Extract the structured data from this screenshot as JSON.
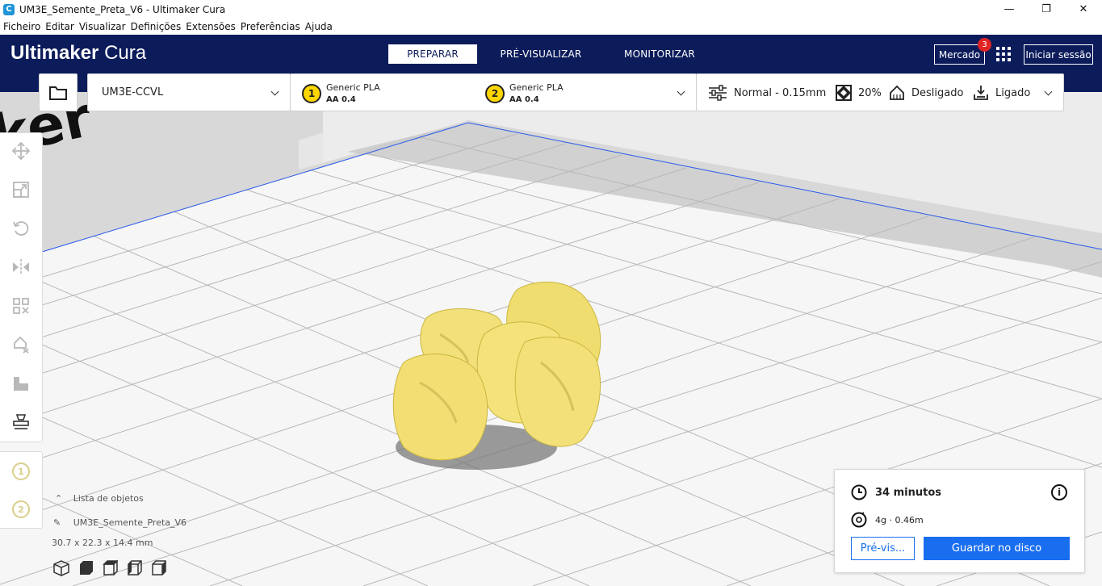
{
  "window": {
    "title": "UM3E_Semente_Preta_V6 - Ultimaker Cura",
    "minimize": "—",
    "restore": "❐",
    "close": "✕"
  },
  "menu": [
    "Ficheiro",
    "Editar",
    "Visualizar",
    "Definições",
    "Extensões",
    "Preferências",
    "Ajuda"
  ],
  "header": {
    "logo_bold": "Ultimaker",
    "logo_light": "Cura",
    "tabs": [
      "PREPARAR",
      "PRÉ-VISUALIZAR",
      "MONITORIZAR"
    ],
    "active_tab": "PREPARAR",
    "market_label": "Mercado",
    "market_badge": "3",
    "signin_label": "Iniciar sessão",
    "colors": {
      "header_bg": "#0c1c5b",
      "accent": "#196ef0"
    }
  },
  "config": {
    "printer": "UM3E-CCVL",
    "extruders": [
      {
        "index": "1",
        "material": "Generic PLA",
        "nozzle": "AA 0.4"
      },
      {
        "index": "2",
        "material": "Generic PLA",
        "nozzle": "AA 0.4"
      }
    ],
    "profile": "Normal - 0.15mm",
    "infill": "20%",
    "support": "Desligado",
    "adhesion": "Ligado"
  },
  "tools": [
    "move-icon",
    "scale-icon",
    "rotate-icon",
    "mirror-icon",
    "per-model-settings-icon",
    "support-blocker-icon",
    "layer-icon",
    "build-plate-icon"
  ],
  "extruder_buttons": [
    "1",
    "2"
  ],
  "object_list": {
    "header": "Lista de objetos",
    "name": "UM3E_Semente_Preta_V6",
    "dimensions": "30.7 x 22.3 x 14.4 mm"
  },
  "print_info": {
    "time": "34 minutos",
    "material": "4g · 0.46m",
    "preview_label": "Pré-vis...",
    "save_label": "Guardar no disco"
  },
  "model_color": "#f2e07a"
}
